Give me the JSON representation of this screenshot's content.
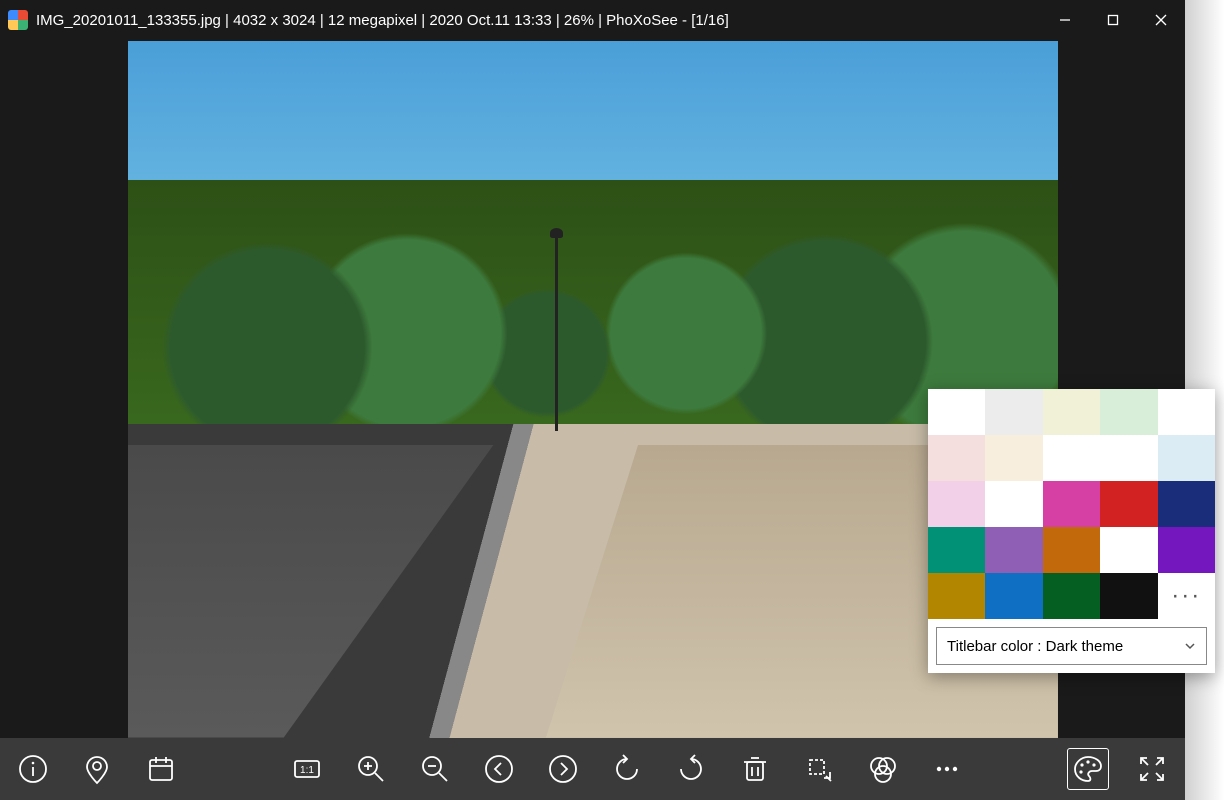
{
  "titlebar": {
    "filename": "IMG_20201011_133355.jpg",
    "dimensions": "4032 x 3024",
    "megapixel": "12 megapixel",
    "datetime": "2020 Oct.11 13:33",
    "zoom": "26%",
    "app": "PhoXoSee",
    "counter": "[1/16]",
    "full": "IMG_20201011_133355.jpg  |  4032 x 3024  |  12 megapixel  |  2020 Oct.11 13:33  |  26%  |  PhoXoSee  -  [1/16]"
  },
  "popup": {
    "swatches": [
      "#FFFFFF",
      "#ECECEC",
      "#F1F1D8",
      "#D8EED8",
      "#FFFFFF",
      "#F5DEDE",
      "#F7EEDD",
      "#FFFFFF",
      "#FFFFFF",
      "#DBECF5",
      "#F2D1E8",
      "#FFFFFF",
      "#D63FA3",
      "#D32222",
      "#1A2D7A",
      "#009176",
      "#8F5FB5",
      "#C26A0B",
      "#FFFFFF",
      "#7517BF",
      "#B38600",
      "#0F6FC2",
      "#055F23",
      "#111111"
    ],
    "more_label": "···",
    "dropdown": "Titlebar color : Dark theme"
  },
  "toolbar_icons": {
    "info": "info-icon",
    "gps": "location-icon",
    "calendar": "calendar-icon",
    "actual": "actual-size-icon",
    "zoomin": "zoom-in-icon",
    "zoomout": "zoom-out-icon",
    "prev": "prev-icon",
    "next": "next-icon",
    "rotl": "rotate-left-icon",
    "rotr": "rotate-right-icon",
    "del": "delete-icon",
    "crop": "crop-icon",
    "filter": "filter-icon",
    "more": "more-icon",
    "palette": "palette-icon",
    "full": "fullscreen-icon"
  }
}
